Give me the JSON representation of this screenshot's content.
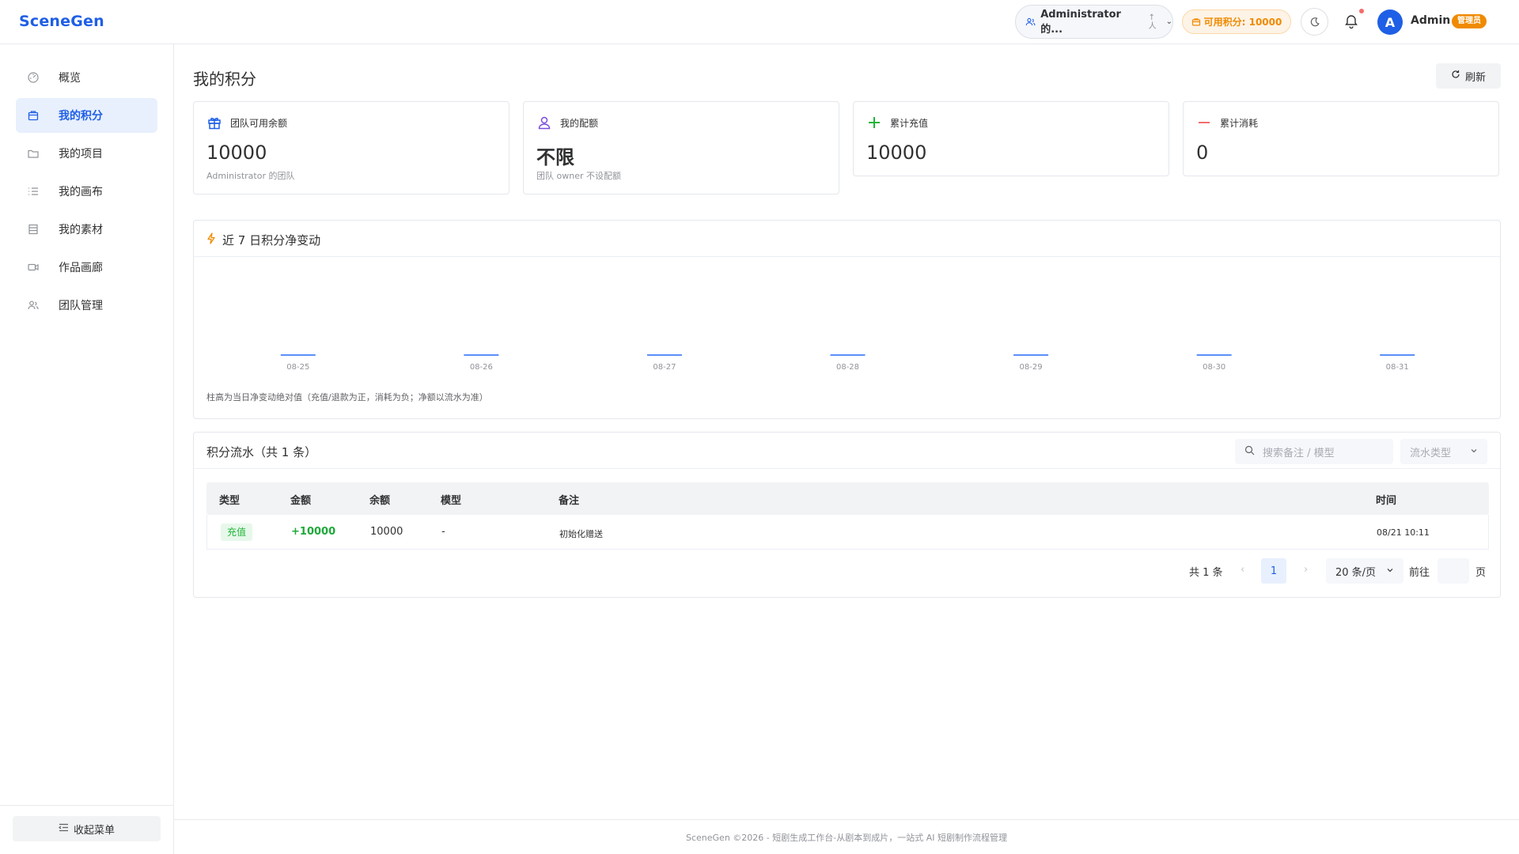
{
  "header": {
    "logo": "SceneGen",
    "team_name": "Administrator 的...",
    "sort_up": "↑",
    "sort_down": "人",
    "points": "可用积分: 10000",
    "username": "Admin",
    "role": "管理员",
    "avatar_letter": "A"
  },
  "sidebar": {
    "items": [
      {
        "label": "概览",
        "icon": "dashboard-icon"
      },
      {
        "label": "我的积分",
        "icon": "wallet-icon",
        "active": true
      },
      {
        "label": "我的项目",
        "icon": "folder-icon"
      },
      {
        "label": "我的画布",
        "icon": "list-icon"
      },
      {
        "label": "我的素材",
        "icon": "document-icon"
      },
      {
        "label": "作品画廊",
        "icon": "video-icon"
      },
      {
        "label": "团队管理",
        "icon": "team-icon"
      }
    ],
    "collapse_label": "收起菜单"
  },
  "main": {
    "title": "我的积分",
    "refresh_label": "刷新"
  },
  "stats": [
    {
      "label": "团队可用余额",
      "value": "10000",
      "sub": "Administrator 的团队",
      "icon": "gift-icon",
      "color": "#1f5fe6"
    },
    {
      "label": "我的配额",
      "value": "不限",
      "sub": "团队 owner 不设配额",
      "icon": "user-icon",
      "color": "#7c4ddb"
    },
    {
      "label": "累计充值",
      "value": "10000",
      "sub": "",
      "icon": "plus-icon",
      "color": "#20b53a"
    },
    {
      "label": "累计消耗",
      "value": "0",
      "sub": "",
      "icon": "minus-icon",
      "color": "#f56c6c"
    }
  ],
  "trend": {
    "title": "近 7 日积分净变动",
    "note": "柱高为当日净变动绝对值（充值/退款为正，消耗为负；净额以流水为准）"
  },
  "chart_data": {
    "type": "bar",
    "categories": [
      "08-25",
      "08-26",
      "08-27",
      "08-28",
      "08-29",
      "08-30",
      "08-31"
    ],
    "values": [
      0,
      0,
      0,
      0,
      0,
      0,
      0
    ],
    "title": "近 7 日积分净变动",
    "bar_color": "#5b8ff9",
    "grid": false
  },
  "ledger": {
    "title": "积分流水（共 1 条）",
    "search_placeholder": "搜索备注 / 模型",
    "type_placeholder": "流水类型",
    "columns": [
      "类型",
      "金额",
      "余额",
      "模型",
      "备注",
      "时间"
    ],
    "rows": [
      {
        "type": "充值",
        "amount": "+10000",
        "balance": "10000",
        "model": "-",
        "note": "初始化赠送",
        "time": "08/21 10:11"
      }
    ],
    "pagination": {
      "total": "共 1 条",
      "prev": "‹",
      "page": "1",
      "next": "›",
      "page_size": "20 条/页",
      "goto": "前往",
      "page_suffix": "页"
    }
  },
  "footer": {
    "text": "SceneGen ©2026 - 短剧生成工作台-从剧本到成片，一站式 AI 短剧制作流程管理"
  }
}
